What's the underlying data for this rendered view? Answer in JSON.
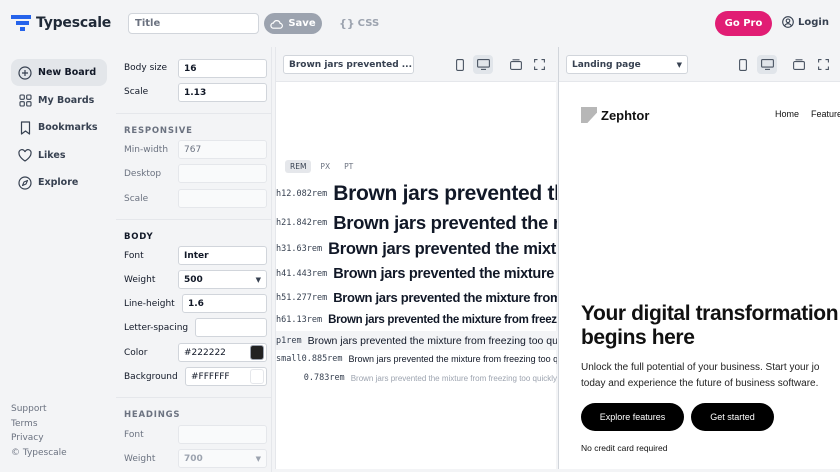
{
  "app": {
    "name": "Typescale",
    "brand_color": "#2563eb"
  },
  "header": {
    "title_placeholder": "Title",
    "save_label": "Save",
    "css_label": "CSS",
    "gopro_label": "Go Pro",
    "login_label": "Login",
    "gopro_color": "#e11d74"
  },
  "nav": {
    "items": [
      {
        "label": "New Board",
        "icon": "plus-circle-icon",
        "active": true
      },
      {
        "label": "My Boards",
        "icon": "grid-icon"
      },
      {
        "label": "Bookmarks",
        "icon": "bookmark-icon"
      },
      {
        "label": "Likes",
        "icon": "heart-icon"
      },
      {
        "label": "Explore",
        "icon": "compass-icon"
      }
    ],
    "footer": [
      "Support",
      "Terms",
      "Privacy",
      "© Typescale"
    ]
  },
  "settings": {
    "body_size_label": "Body size",
    "body_size": "16",
    "scale_label": "Scale",
    "scale": "1.13",
    "responsive_heading": "RESPONSIVE",
    "min_width_label": "Min-width",
    "min_width": "767",
    "desktop_label": "Desktop",
    "desktop": "",
    "r_scale_label": "Scale",
    "r_scale": "",
    "body_heading": "BODY",
    "font_label": "Font",
    "font": "Inter",
    "weight_label": "Weight",
    "weight": "500",
    "line_height_label": "Line-height",
    "line_height": "1.6",
    "letter_spacing_label": "Letter-spacing",
    "letter_spacing": "",
    "color_label": "Color",
    "color": "#222222",
    "background_label": "Background",
    "background": "#FFFFFF",
    "headings_heading": "HEADINGS",
    "h_font_label": "Font",
    "h_font": "",
    "h_weight_label": "Weight",
    "h_weight": "700"
  },
  "preview": {
    "sample_select": "Brown jars prevented ...",
    "units": [
      "REM",
      "PX",
      "PT"
    ],
    "active_unit": "REM",
    "sample_text": "Brown jars prevented the mixture from freezing too quickly",
    "rows": [
      {
        "tag": "h1",
        "value": "2.082rem"
      },
      {
        "tag": "h2",
        "value": "1.842rem"
      },
      {
        "tag": "h3",
        "value": "1.63rem"
      },
      {
        "tag": "h4",
        "value": "1.443rem"
      },
      {
        "tag": "h5",
        "value": "1.277rem"
      },
      {
        "tag": "h6",
        "value": "1.13rem"
      },
      {
        "tag": "p",
        "value": "1rem"
      },
      {
        "tag": "small",
        "value": "0.885rem"
      },
      {
        "tag": "",
        "value": "0.783rem"
      }
    ]
  },
  "landing": {
    "template_select": "Landing page",
    "brand": "Zephtor",
    "nav": [
      "Home",
      "Features"
    ],
    "headline": "Your digital transformation begins here",
    "subtext_line1": "Unlock the full potential of your business. Start your jo",
    "subtext_line2": "today and experience the future of business software.",
    "cta_primary": "Explore features",
    "cta_secondary": "Get started",
    "note": "No credit card required"
  }
}
